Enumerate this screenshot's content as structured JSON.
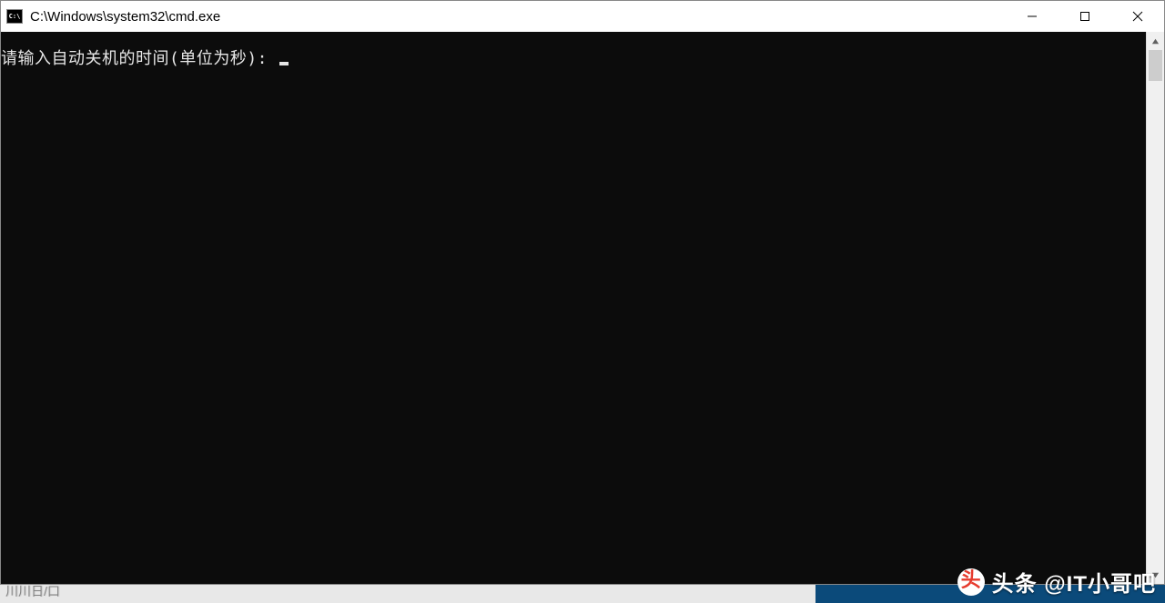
{
  "window": {
    "icon_label": "C:\\",
    "title": "C:\\Windows\\system32\\cmd.exe"
  },
  "console": {
    "prompt": "请输入自动关机的时间(单位为秒): "
  },
  "taskbar": {
    "fragment_text": "川川日/口"
  },
  "watermark": {
    "icon_glyph": "头",
    "text": "头条 @IT小哥吧"
  }
}
